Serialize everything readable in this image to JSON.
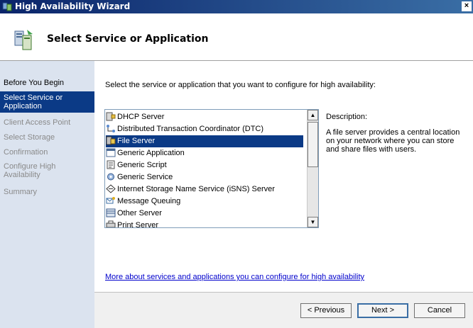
{
  "window": {
    "title": "High Availability Wizard",
    "close_glyph": "×"
  },
  "header": {
    "title": "Select Service or Application"
  },
  "sidebar": {
    "items": [
      {
        "label": "Before You Begin",
        "state": "done"
      },
      {
        "label": "Select Service or Application",
        "state": "active"
      },
      {
        "label": "Client Access Point",
        "state": "pending"
      },
      {
        "label": "Select Storage",
        "state": "pending"
      },
      {
        "label": "Confirmation",
        "state": "pending"
      },
      {
        "label": "Configure High Availability",
        "state": "pending"
      },
      {
        "label": "Summary",
        "state": "pending"
      }
    ]
  },
  "main": {
    "prompt": "Select the service or application that you want to configure for high availability:",
    "list": {
      "items": [
        {
          "label": "DHCP Server",
          "icon": "dhcp-server-icon"
        },
        {
          "label": "Distributed Transaction Coordinator (DTC)",
          "icon": "dtc-icon"
        },
        {
          "label": "File Server",
          "icon": "file-server-icon",
          "selected": true
        },
        {
          "label": "Generic Application",
          "icon": "generic-application-icon"
        },
        {
          "label": "Generic Script",
          "icon": "generic-script-icon"
        },
        {
          "label": "Generic Service",
          "icon": "generic-service-icon"
        },
        {
          "label": "Internet Storage Name Service (iSNS) Server",
          "icon": "isns-icon"
        },
        {
          "label": "Message Queuing",
          "icon": "message-queuing-icon"
        },
        {
          "label": "Other Server",
          "icon": "other-server-icon"
        },
        {
          "label": "Print Server",
          "icon": "print-server-icon"
        }
      ]
    },
    "description": {
      "label": "Description:",
      "text": "A file server provides a central location on your network where you can store and share files with users."
    },
    "more_link": "More about services and applications you can configure for high availability"
  },
  "footer": {
    "previous": "< Previous",
    "next": "Next >",
    "cancel": "Cancel"
  }
}
